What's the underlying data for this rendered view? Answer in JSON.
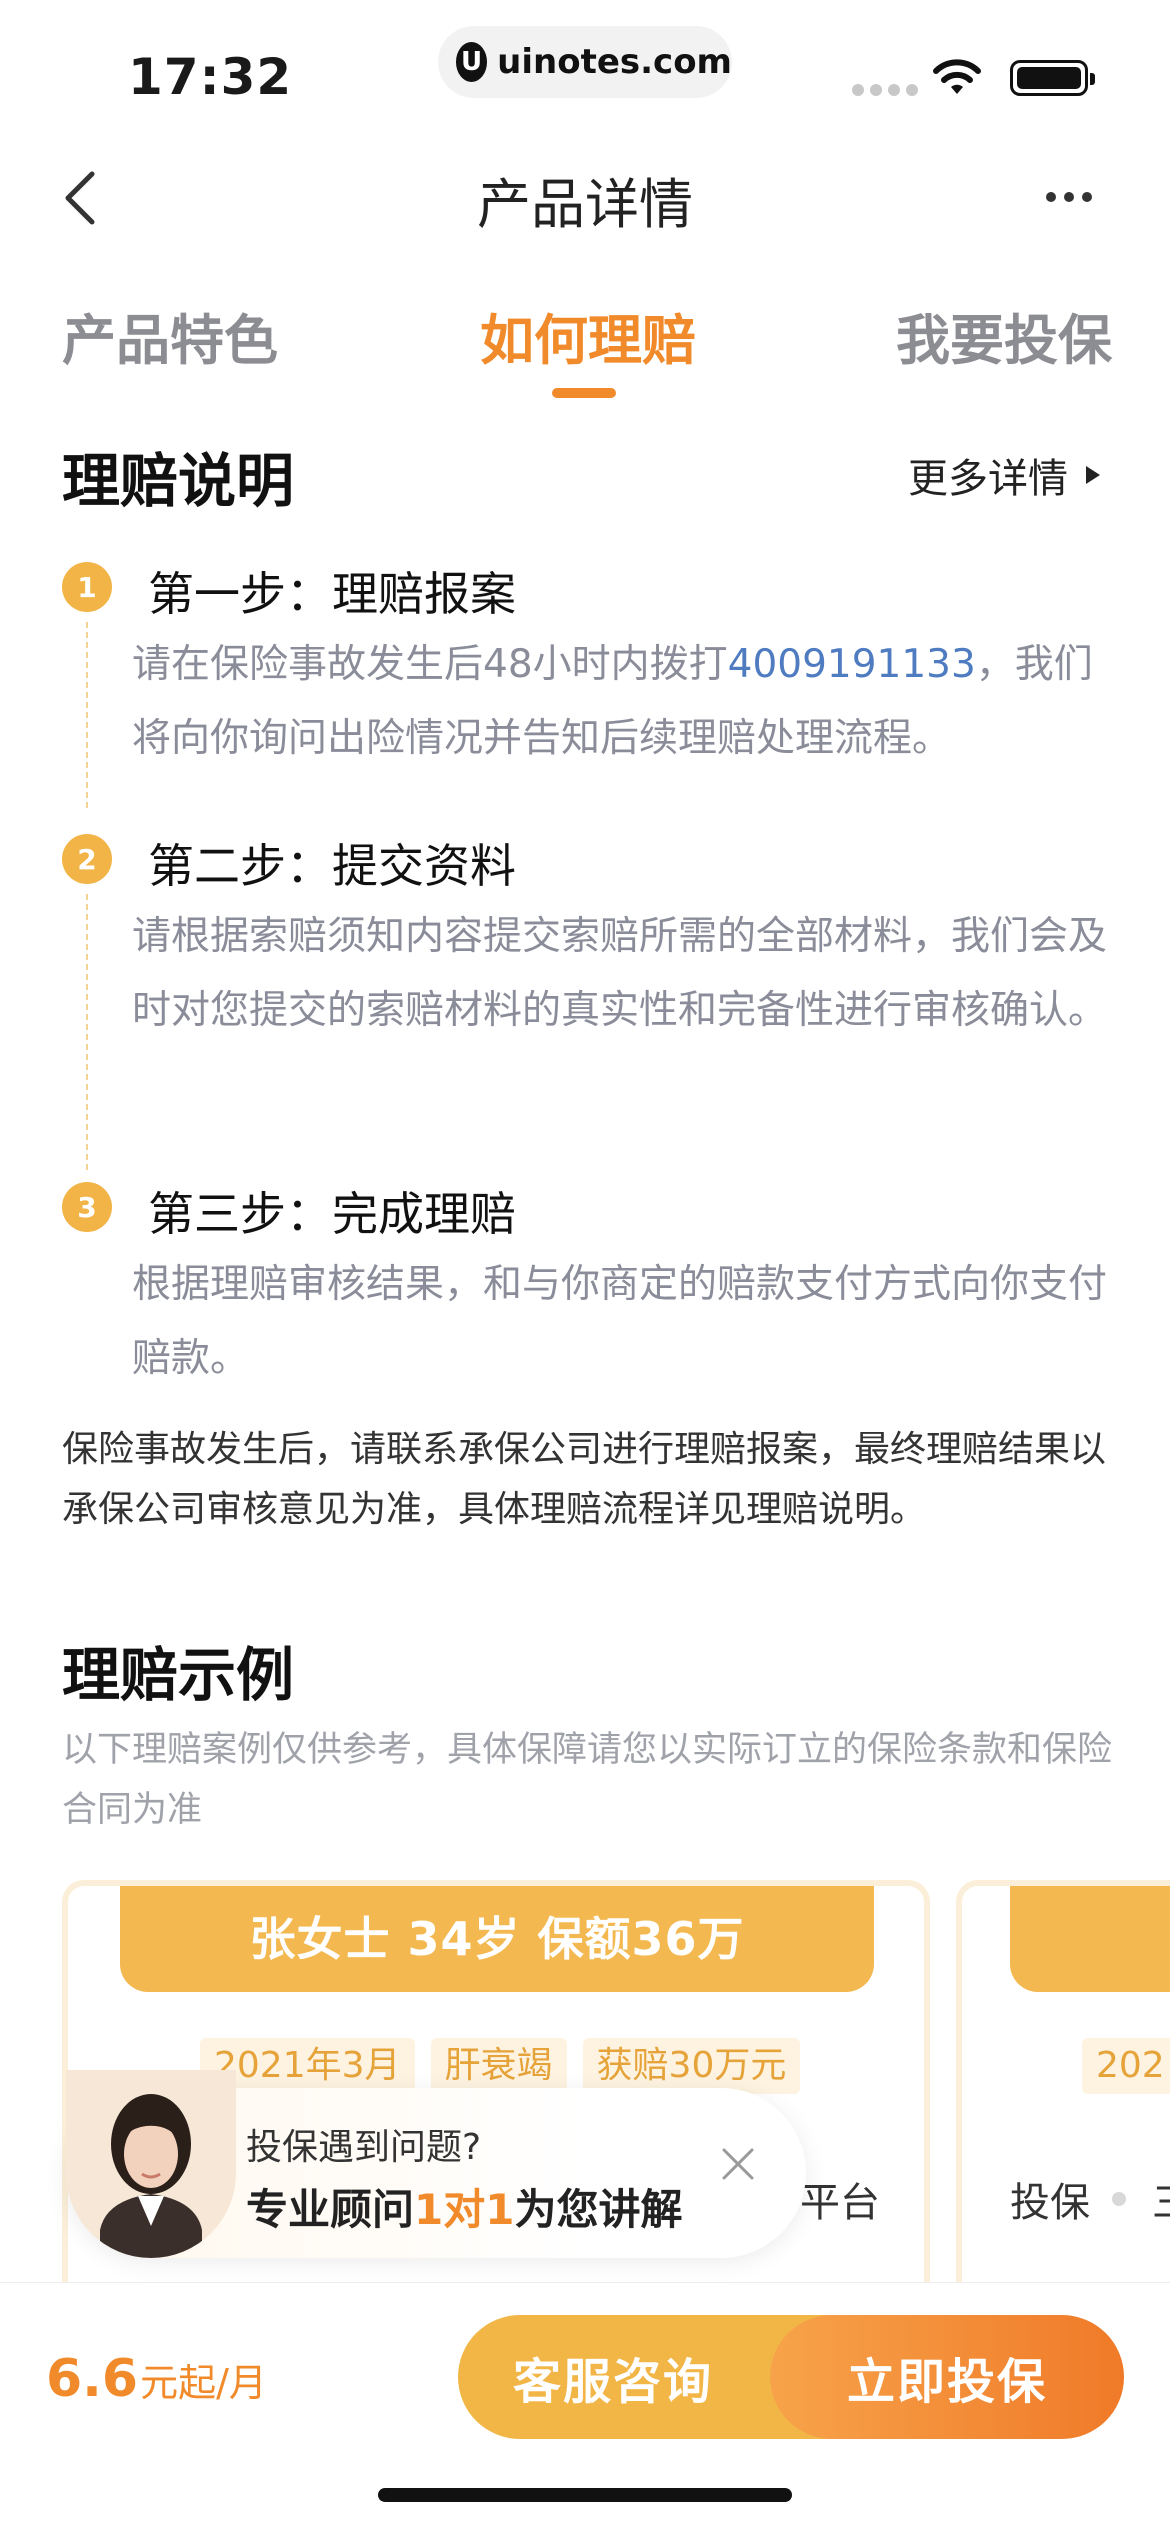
{
  "status_bar": {
    "time": "17:32",
    "url_icon": "U",
    "url": "uinotes.com"
  },
  "nav": {
    "title": "产品详情"
  },
  "tabs": [
    {
      "label": "产品特色",
      "active": false
    },
    {
      "label": "如何理赔",
      "active": true
    },
    {
      "label": "我要投保",
      "active": false
    }
  ],
  "claim_info": {
    "title": "理赔说明",
    "more_label": "更多详情",
    "steps": [
      {
        "number": "1",
        "title": "第一步：理赔报案",
        "desc_before": "请在保险事故发生后48小时内拨打",
        "phone": "4009191133",
        "desc_after": "，我们将向你询问出险情况并告知后续理赔处理流程。"
      },
      {
        "number": "2",
        "title": "第二步：提交资料",
        "desc": "请根据索赔须知内容提交索赔所需的全部材料，我们会及时对您提交的索赔材料的真实性和完备性进行审核确认。"
      },
      {
        "number": "3",
        "title": "第三步：完成理赔",
        "desc": "根据理赔审核结果，和与你商定的赔款支付方式向你支付赔款。"
      }
    ],
    "note": "保险事故发生后，请联系承保公司进行理赔报案，最终理赔结果以承保公司审核意见为准，具体理赔流程详见理赔说明。"
  },
  "claim_examples": {
    "title": "理赔示例",
    "subtitle": "以下理赔案例仅供参考，具体保障请您以实际订立的保险条款和保险合同为准",
    "cards": [
      {
        "header": "张女士 34岁 保额36万",
        "tags": [
          "2021年3月",
          "肝衰竭",
          "获赔30万元"
        ],
        "partial_text": "平台"
      },
      {
        "tag": "202",
        "label": "投保",
        "partial_text": "三"
      }
    ]
  },
  "advisor": {
    "question": "投保遇到问题?",
    "answer_prefix": "专业顾问",
    "answer_highlight": "1对1",
    "answer_suffix": "为您讲解"
  },
  "bottom_bar": {
    "price_number": "6.6",
    "price_unit": "元起/月",
    "consult_label": "客服咨询",
    "buy_label": "立即投保"
  },
  "colors": {
    "accent": "#f08a2a",
    "badge": "#f2b446",
    "link": "#4f7bc1"
  }
}
